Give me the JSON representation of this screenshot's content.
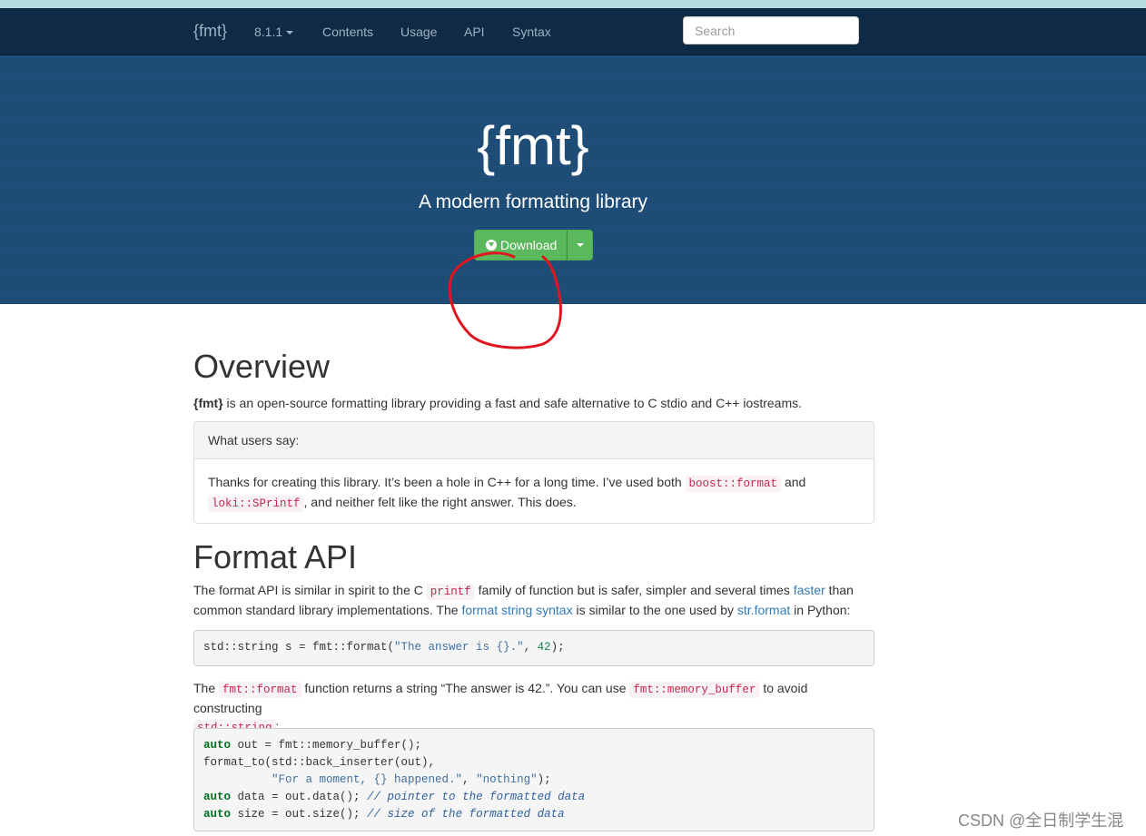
{
  "nav": {
    "brand": "{fmt}",
    "version": "8.1.1",
    "links": [
      "Contents",
      "Usage",
      "API",
      "Syntax"
    ],
    "search_placeholder": "Search"
  },
  "hero": {
    "title": "{fmt}",
    "subtitle": "A modern formatting library",
    "download_label": "Download"
  },
  "overview": {
    "heading": "Overview",
    "lead_bold": "{fmt}",
    "lead_text": " is an open-source formatting library providing a fast and safe alternative to C stdio and C++ iostreams.",
    "panel_title": "What users say:",
    "quote_1": "Thanks for creating this library. It’s been a hole in C++ for a long time. I’ve used both ",
    "quote_code_1": "boost::format",
    "quote_2": " and",
    "quote_code_2": "loki::SPrintf",
    "quote_3": ", and neither felt like the right answer. This does."
  },
  "format_api": {
    "heading": "Format API",
    "p1_a": "The format API is similar in spirit to the C ",
    "p1_code": "printf",
    "p1_b": " family of function but is safer, simpler and several times ",
    "p1_link_faster": "faster",
    "p1_c": " than",
    "p1_d": "common standard library implementations. The ",
    "p1_link_syntax": "format string syntax",
    "p1_e": " is similar to the one used by ",
    "p1_link_str": "str.format",
    "p1_f": " in Python:",
    "code1_a": "std::string s = fmt::format(",
    "code1_str": "\"The answer is {}.\"",
    "code1_b": ", ",
    "code1_num": "42",
    "code1_c": ");",
    "p2_a": "The ",
    "p2_code1": "fmt::format",
    "p2_b": " function returns a string “The answer is 42.”. You can use ",
    "p2_code2": "fmt::memory_buffer",
    "p2_c": " to avoid constructing",
    "p2_code3": "std::string",
    "p2_d": ":",
    "code2": {
      "kw_auto": "auto",
      "l1": " out = fmt::memory_buffer();",
      "l2": "format_to(std::back_inserter(out),",
      "l3_indent": "          ",
      "l3_str1": "\"For a moment, {} happened.\"",
      "l3_mid": ", ",
      "l3_str2": "\"nothing\"",
      "l3_end": ");",
      "l4": " data = out.data(); ",
      "l4_cm": "// pointer to the formatted data",
      "l5": " size = out.size(); ",
      "l5_cm": "// size of the formatted data"
    }
  },
  "watermark": "CSDN @全日制学生混",
  "colors": {
    "navbar": "#0f2a44",
    "hero": "#1f4e79",
    "download_button": "#5cb85c",
    "link": "#337ab7",
    "inline_code": "#c7254e",
    "annotation_circle": "#e0151f"
  }
}
